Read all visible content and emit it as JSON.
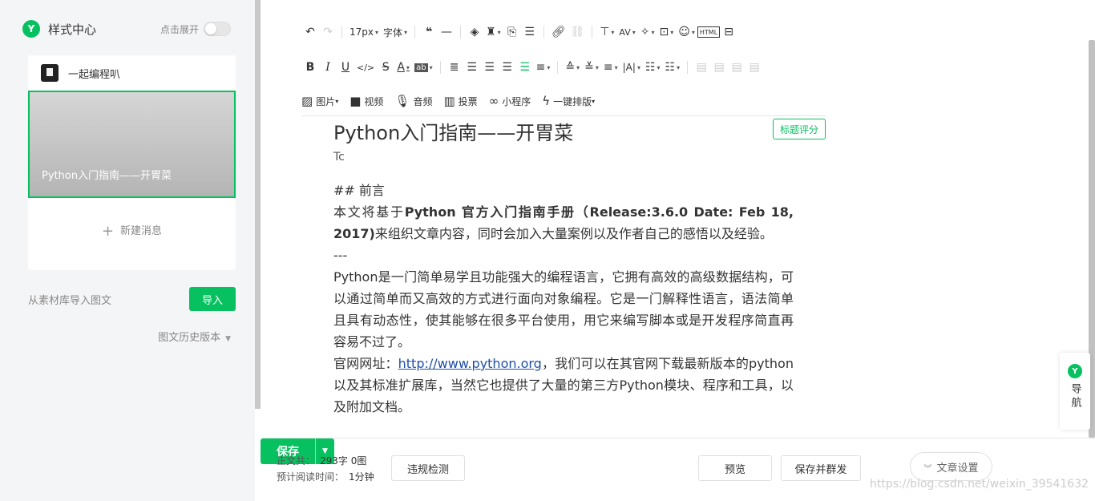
{
  "left_panel": {
    "title": "样式中心",
    "expand_label": "点击展开",
    "account_name": "一起编程叭",
    "article_title": "Python入门指南——开胃菜",
    "new_message": "新建消息",
    "import_text": "从素材库导入图文",
    "import_button": "导入",
    "history": "图文历史版本"
  },
  "toolbar": {
    "font_size": "17px",
    "font_family": "字体",
    "insert_image": "图片",
    "insert_video": "视频",
    "insert_audio": "音频",
    "insert_vote": "投票",
    "insert_miniprogram": "小程序",
    "one_click_layout": "一键排版"
  },
  "editor": {
    "title": "Python入门指南——开胃菜",
    "score_button": "标题评分",
    "author": "Tc",
    "heading": "## 前言",
    "para1_prefix": "本文将基于",
    "para1_bold": "Python 官方入门指南手册（Release:3.6.0 Date: Feb 18, 2017)",
    "para1_suffix": "来组织文章内容，同时会加入大量案例以及作者自己的感悟以及经验。",
    "hr": "---",
    "para2": "Python是一门简单易学且功能强大的编程语言，它拥有高效的高级数据结构，可以通过简单而又高效的方式进行面向对象编程。它是一门解释性语言，语法简单且具有动态性，使其能够在很多平台使用，用它来编写脚本或是开发程序简直再容易不过了。",
    "para3_label": "官网网址：",
    "para3_link": "http://www.python.org",
    "para3_suffix": "，我们可以在其官网下载最新版本的python以及其标准扩展库，当然它也提供了大量的第三方Python模块、程序和工具，以及附加文档。"
  },
  "nav_float": {
    "label": "导航"
  },
  "bottom_bar": {
    "word_count_label": "正文共：",
    "word_count_value": "293字 0图",
    "read_time_label": "预计阅读时间：",
    "read_time_value": "1分钟",
    "check_button": "违规检测",
    "save_button": "保存",
    "preview_button": "预览",
    "save_send_button": "保存并群发",
    "settings_button": "文章设置"
  },
  "watermark": "https://blog.csdn.net/weixin_39541632",
  "colors": {
    "accent": "#07c160",
    "link": "#1e4fa8"
  }
}
